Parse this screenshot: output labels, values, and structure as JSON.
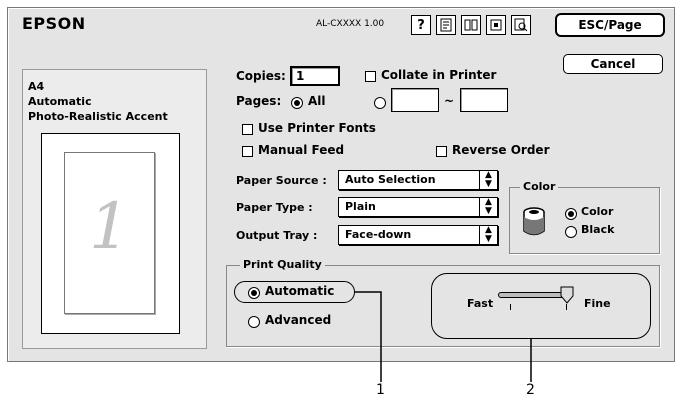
{
  "header": {
    "brand": "EPSON",
    "model": "AL-CXXXX 1.00",
    "esc_page_label": "ESC/Page",
    "cancel_label": "Cancel",
    "help_glyph": "?"
  },
  "summary": {
    "paper_size": "A4",
    "mode": "Automatic",
    "setting": "Photo-Realistic Accent",
    "preview_page_number": "1"
  },
  "copies": {
    "label": "Copies:",
    "value": "1"
  },
  "collate": {
    "label": "Collate in Printer",
    "checked": false
  },
  "pages": {
    "label": "Pages:",
    "all_label": "All",
    "range_from": "",
    "range_sep": "~",
    "range_to": ""
  },
  "use_printer_fonts": {
    "label": "Use Printer Fonts",
    "checked": false
  },
  "manual_feed": {
    "label": "Manual Feed",
    "checked": false
  },
  "reverse_order": {
    "label": "Reverse Order",
    "checked": false
  },
  "paper_source": {
    "label": "Paper Source :",
    "value": "Auto Selection"
  },
  "paper_type": {
    "label": "Paper Type :",
    "value": "Plain"
  },
  "output_tray": {
    "label": "Output Tray :",
    "value": "Face-down"
  },
  "color_group": {
    "title": "Color",
    "color_label": "Color",
    "black_label": "Black",
    "selected": "Color"
  },
  "print_quality": {
    "title": "Print Quality",
    "automatic_label": "Automatic",
    "advanced_label": "Advanced",
    "selected": "Automatic",
    "slider_fast_label": "Fast",
    "slider_fine_label": "Fine",
    "slider_value": 1.0
  },
  "callouts": {
    "one": "1",
    "two": "2"
  }
}
